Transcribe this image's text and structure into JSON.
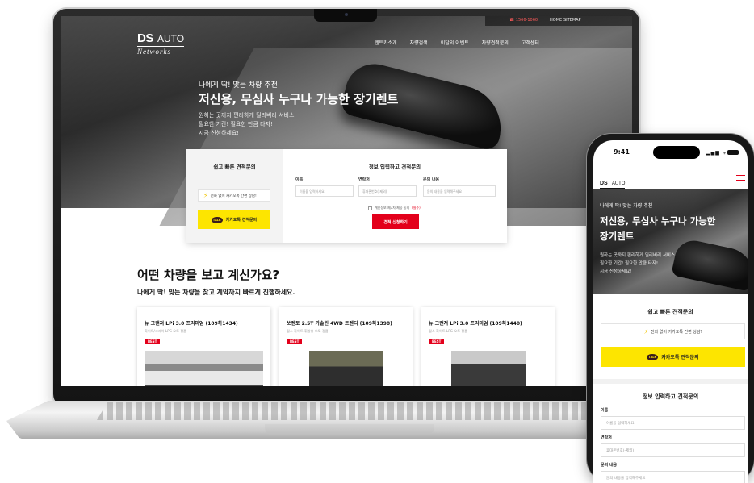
{
  "site": {
    "logo_ds": "DS",
    "logo_auto": "AUTO",
    "logo_networks": "Networks",
    "top_strip": {
      "phone": "☎ 1566-1060",
      "home": "HOME",
      "sitemap": "SITEMAP"
    },
    "nav": [
      "렌트카소개",
      "차량검색",
      "이달의 이벤트",
      "차량견적문의",
      "고객센터"
    ]
  },
  "hero": {
    "subtitle": "나에게 딱! 맞는 차량 추천",
    "title": "저신용, 무심사 누구나 가능한 장기렌트",
    "desc_lines": [
      "원하는 곳까지 편리하게 딜리버리 서비스",
      "필요한 기간! 필요한 만큼 타자!",
      "지금 신청하세요!"
    ]
  },
  "estimate": {
    "quick_title": "쉽고 빠른 견적문의",
    "call_label": "전화 없이 카카오톡 간편 상담!",
    "kakao_badge": "TALK",
    "kakao_label": "카카오톡 견적문의",
    "form_title": "정보 입력하고 견적문의",
    "fields": [
      {
        "label": "이름",
        "placeholder": "이름을 입력하세요"
      },
      {
        "label": "연락처",
        "placeholder": "휴대폰번호(-제외)"
      },
      {
        "label": "문의 내용",
        "placeholder": "문의 내용을 입력해주세요"
      }
    ],
    "agree_label": "개인정보 제3자 제공 동의",
    "agree_required": "(필수)",
    "submit_label": "견적 신청하기"
  },
  "listing": {
    "title": "어떤 차량을 보고 계신가요?",
    "subtitle": "나에게 딱! 맞는 차량을 찾고 계약까지 빠르게 진행하세요.",
    "cars": [
      {
        "name": "뉴 그랜저 LPi 3.0 프리미엄 (109하1434)",
        "meta": "화이트/그레이   LPG   오토   정품",
        "badge": "BEST"
      },
      {
        "name": "쏘렌토 2.5T 가솔린 4WD 트렌디 (109하1398)",
        "meta": "펄스 화이트   휘발유   오토   정품",
        "badge": "BEST"
      },
      {
        "name": "뉴 그랜저 LPi 3.0 프리미엄 (109하1440)",
        "meta": "펄스 화이트   LPG   오토   정품",
        "badge": "BEST"
      }
    ]
  },
  "phone": {
    "time": "9:41",
    "status_icons": "▂▄▆ ᯤ",
    "hero_title_lines": [
      "저신용, 무심사 누구나 가능한",
      "장기렌트"
    ],
    "call_label": "전화 없이 카카오톡 간편 상담!",
    "form_fields": [
      {
        "label": "이름",
        "placeholder": "이름을 입력하세요"
      },
      {
        "label": "연락처",
        "placeholder": "휴대폰번호(-제외)"
      },
      {
        "label": "문의 내용",
        "placeholder": "문의 내용을 입력해주세요"
      }
    ]
  },
  "colors": {
    "brand_red": "#e3001b",
    "kakao_yellow": "#fde500"
  }
}
